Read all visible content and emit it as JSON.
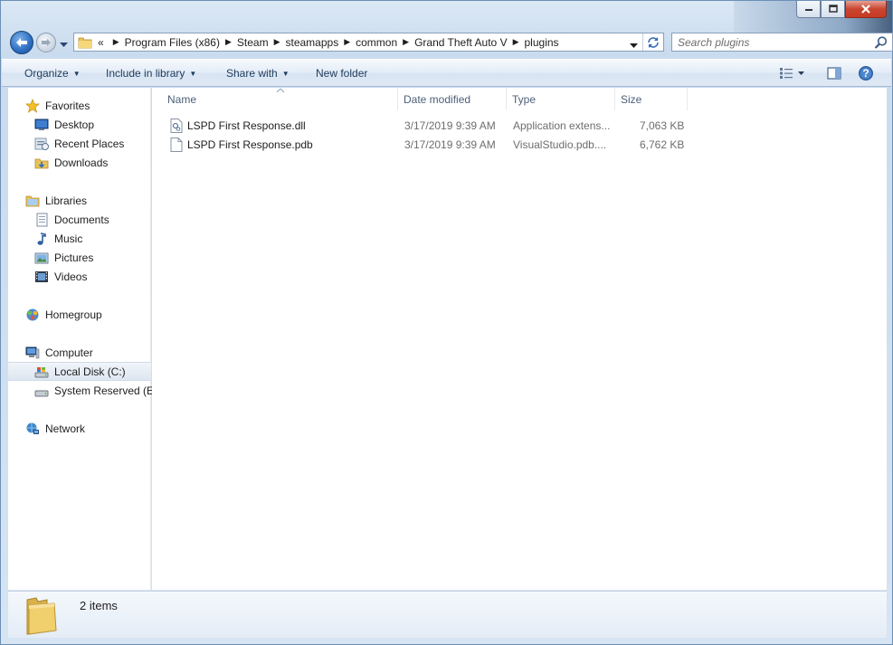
{
  "window": {
    "controls": {
      "minimize": "minimize",
      "maximize": "maximize",
      "close": "close"
    }
  },
  "nav": {
    "breadcrumb_overflow": "«",
    "breadcrumbs": [
      "Program Files (x86)",
      "Steam",
      "steamapps",
      "common",
      "Grand Theft Auto V",
      "plugins"
    ],
    "search_placeholder": "Search plugins"
  },
  "commandbar": {
    "organize": "Organize",
    "include_in_library": "Include in library",
    "share_with": "Share with",
    "new_folder": "New folder"
  },
  "sidebar": {
    "favorites": {
      "label": "Favorites",
      "items": [
        "Desktop",
        "Recent Places",
        "Downloads"
      ]
    },
    "libraries": {
      "label": "Libraries",
      "items": [
        "Documents",
        "Music",
        "Pictures",
        "Videos"
      ]
    },
    "homegroup": {
      "label": "Homegroup"
    },
    "computer": {
      "label": "Computer",
      "items": [
        "Local Disk (C:)",
        "System Reserved (E:)"
      ],
      "selected": "Local Disk (C:)"
    },
    "network": {
      "label": "Network"
    }
  },
  "columns": [
    "Name",
    "Date modified",
    "Type",
    "Size"
  ],
  "files": [
    {
      "name": "LSPD First Response.dll",
      "date": "3/17/2019 9:39 AM",
      "type": "Application extens...",
      "size": "7,063 KB"
    },
    {
      "name": "LSPD First Response.pdb",
      "date": "3/17/2019 9:39 AM",
      "type": "VisualStudio.pdb....",
      "size": "6,762 KB"
    }
  ],
  "details": {
    "count": "2 items"
  },
  "colors": {
    "accent": "#2d6dc0",
    "close": "#c73a22",
    "selection": "#dde6f1"
  }
}
